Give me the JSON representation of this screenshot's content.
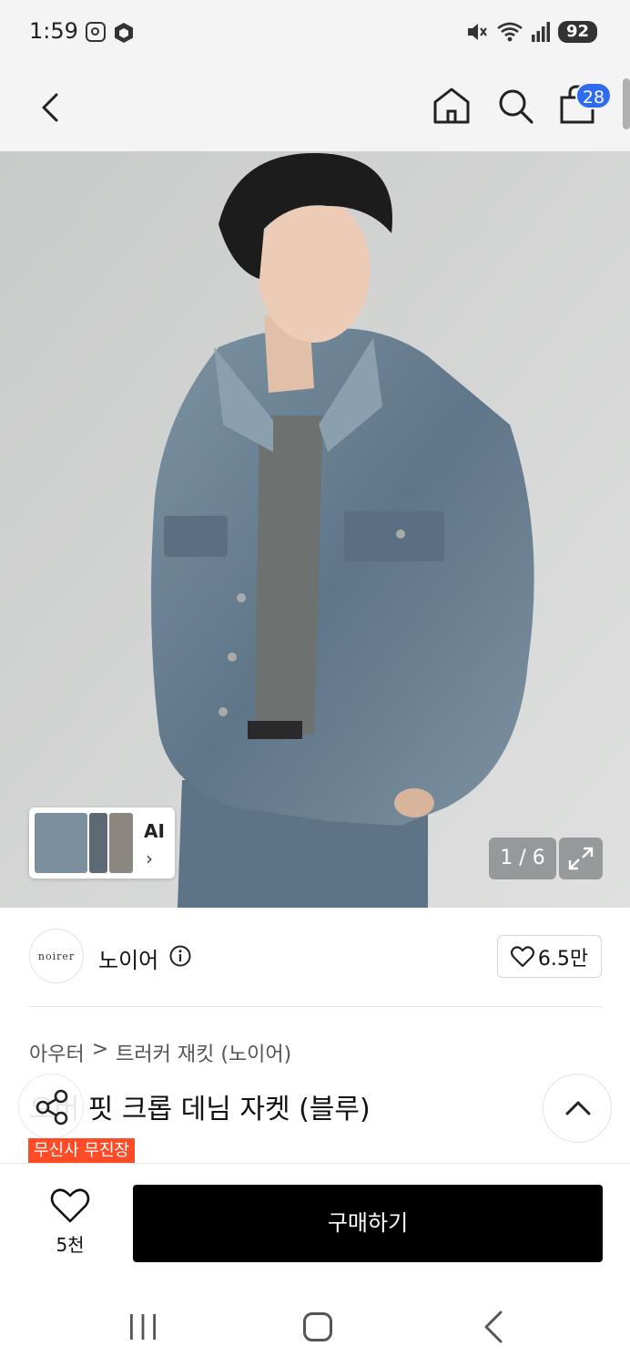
{
  "status_bar": {
    "time": "1:59",
    "battery": "92"
  },
  "header": {
    "cart_count": "28"
  },
  "hero": {
    "ai_label": "AI",
    "ai_chevron": "›",
    "counter": "1 / 6"
  },
  "brand": {
    "logo_text": "noirer",
    "name": "노이어",
    "like_count": "6.5만"
  },
  "product": {
    "breadcrumb": [
      "아우터",
      ">",
      "트러커 재킷 (노이어)"
    ],
    "title": "오버 핏 크롭 데님 자켓 (블루)",
    "badge": "무신사 무진장"
  },
  "bottom": {
    "wish_count": "5천",
    "buy_label": "구매하기"
  },
  "colors": {
    "accent": "#2f6bf0",
    "badge": "#ff4b26",
    "buy_button": "#000000"
  },
  "icons": [
    "back-icon",
    "home-icon",
    "search-icon",
    "cart-icon",
    "expand-icon",
    "info-icon",
    "heart-icon",
    "share-icon",
    "chevron-up-icon"
  ]
}
